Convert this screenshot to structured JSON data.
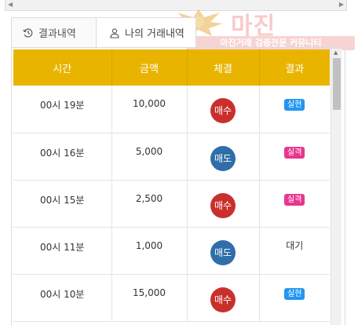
{
  "tabs": [
    {
      "label": "결과내역",
      "icon": "history-icon",
      "active": false
    },
    {
      "label": "나의 거래내역",
      "icon": "user-icon",
      "active": true
    }
  ],
  "watermark": {
    "brand": "마진",
    "banner": "마진거래 검증전문 커뮤니티"
  },
  "table": {
    "headers": [
      "시간",
      "금액",
      "체결",
      "결과"
    ],
    "rows": [
      {
        "time": "00시 19분",
        "amount": "10,000",
        "trade": "매수",
        "trade_type": "buy",
        "result": "실현",
        "result_type": "hit"
      },
      {
        "time": "00시 16분",
        "amount": "5,000",
        "trade": "매도",
        "trade_type": "sell",
        "result": "실격",
        "result_type": "miss"
      },
      {
        "time": "00시 15분",
        "amount": "2,500",
        "trade": "매수",
        "trade_type": "buy",
        "result": "실격",
        "result_type": "miss"
      },
      {
        "time": "00시 11분",
        "amount": "1,000",
        "trade": "매도",
        "trade_type": "sell",
        "result": "대기",
        "result_type": "plain"
      },
      {
        "time": "00시 10분",
        "amount": "15,000",
        "trade": "매수",
        "trade_type": "buy",
        "result": "실현",
        "result_type": "hit"
      }
    ]
  },
  "colors": {
    "header": "#e8b400",
    "buy": "#c9302c",
    "sell": "#2f6ea8",
    "hit": "#2196f3",
    "miss": "#e8368f"
  }
}
